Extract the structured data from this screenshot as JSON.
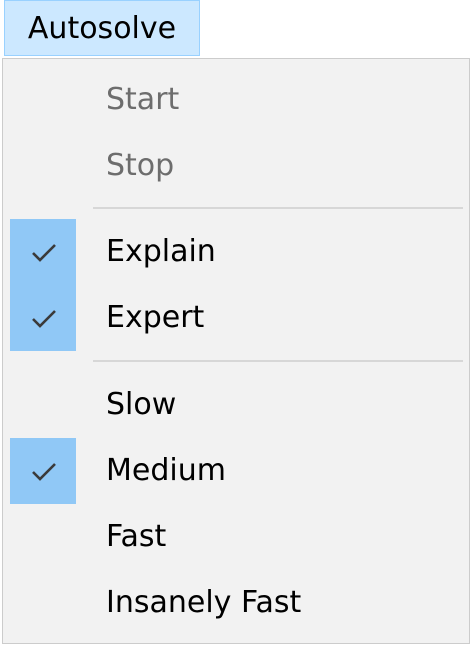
{
  "menubar": {
    "menu_label": "Autosolve"
  },
  "menu": {
    "items": [
      {
        "label": "Start",
        "checked": false,
        "enabled": false
      },
      {
        "label": "Stop",
        "checked": false,
        "enabled": false
      },
      {
        "label": "Explain",
        "checked": true,
        "enabled": true
      },
      {
        "label": "Expert",
        "checked": true,
        "enabled": true
      },
      {
        "label": "Slow",
        "checked": false,
        "enabled": true
      },
      {
        "label": "Medium",
        "checked": true,
        "enabled": true
      },
      {
        "label": "Fast",
        "checked": false,
        "enabled": true
      },
      {
        "label": "Insanely Fast",
        "checked": false,
        "enabled": true
      }
    ]
  },
  "colors": {
    "menubar_highlight": "#cce8ff",
    "check_highlight": "#90c8f6",
    "disabled_text": "#6d6d6d"
  }
}
